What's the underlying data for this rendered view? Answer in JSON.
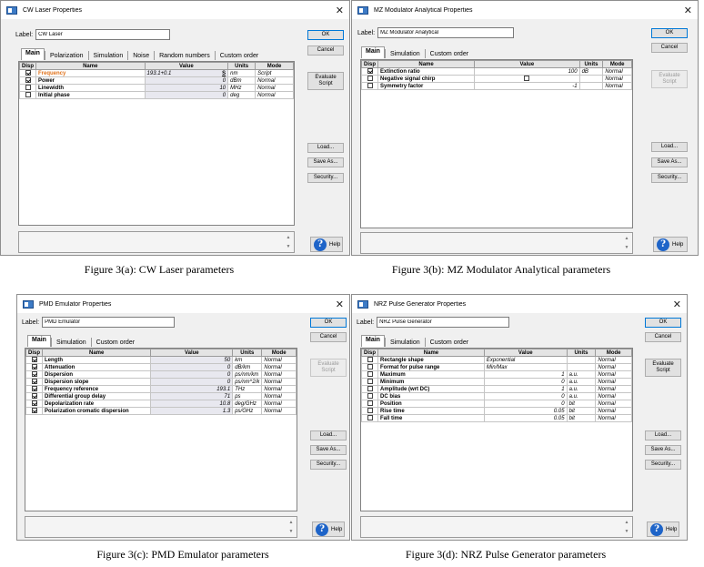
{
  "common": {
    "label_text": "Label:",
    "ok": "OK",
    "cancel": "Cancel",
    "evaluate_script": "Evaluate Script",
    "load": "Load...",
    "save_as": "Save As...",
    "security": "Security...",
    "help": "Help",
    "headers": {
      "disp": "Disp",
      "name": "Name",
      "value": "Value",
      "units": "Units",
      "mode": "Mode"
    }
  },
  "panel_a": {
    "title": "CW Laser Properties",
    "label_value": "CW Laser",
    "tabs": [
      "Main",
      "Polarization",
      "Simulation",
      "Noise",
      "Random numbers",
      "Custom order"
    ],
    "rows": [
      {
        "checked": true,
        "name": "Frequency",
        "value": "193.1+0.1",
        "units": "nm",
        "mode": "Script"
      },
      {
        "checked": true,
        "name": "Power",
        "value": "0",
        "units": "dBm",
        "mode": "Normal"
      },
      {
        "checked": false,
        "name": "Linewidth",
        "value": "10",
        "units": "MHz",
        "mode": "Normal"
      },
      {
        "checked": false,
        "name": "Initial phase",
        "value": "0",
        "units": "deg",
        "mode": "Normal"
      }
    ],
    "script_marker": "S",
    "caption": "Figure 3(a): CW Laser parameters"
  },
  "panel_b": {
    "title": "MZ Modulator Analytical Properties",
    "label_value": "MZ Modulator Analytical",
    "tabs": [
      "Main",
      "Simulation",
      "Custom order"
    ],
    "rows": [
      {
        "checked": true,
        "name": "Extinction ratio",
        "value": "100",
        "units": "dB",
        "mode": "Normal"
      },
      {
        "checked": false,
        "name": "Negative signal chirp",
        "value": "",
        "units": "",
        "mode": "Normal",
        "value_checkbox": true
      },
      {
        "checked": false,
        "name": "Symmetry factor",
        "value": "-1",
        "units": "",
        "mode": "Normal"
      }
    ],
    "caption": "Figure 3(b): MZ Modulator Analytical parameters"
  },
  "panel_c": {
    "title": "PMD Emulator Properties",
    "label_value": "PMD Emulator",
    "tabs": [
      "Main",
      "Simulation",
      "Custom order"
    ],
    "rows": [
      {
        "checked": true,
        "name": "Length",
        "value": "50",
        "units": "km",
        "mode": "Normal"
      },
      {
        "checked": true,
        "name": "Attenuation",
        "value": "0",
        "units": "dB/km",
        "mode": "Normal"
      },
      {
        "checked": true,
        "name": "Dispersion",
        "value": "0",
        "units": "ps/nm/km",
        "mode": "Normal"
      },
      {
        "checked": true,
        "name": "Dispersion slope",
        "value": "0",
        "units": "ps/nm^2/k",
        "mode": "Normal"
      },
      {
        "checked": true,
        "name": "Frequency reference",
        "value": "193.1",
        "units": "THz",
        "mode": "Normal"
      },
      {
        "checked": true,
        "name": "Differential group delay",
        "value": "71",
        "units": "ps",
        "mode": "Normal"
      },
      {
        "checked": true,
        "name": "Depolarization rate",
        "value": "10.8",
        "units": "deg/GHz",
        "mode": "Normal"
      },
      {
        "checked": true,
        "name": "Polarization cromatic dispersion",
        "value": "1.3",
        "units": "ps/GHz",
        "mode": "Normal"
      }
    ],
    "caption": "Figure 3(c): PMD Emulator parameters"
  },
  "panel_d": {
    "title": "NRZ Pulse Generator Properties",
    "label_value": "NRZ Pulse Generator",
    "tabs": [
      "Main",
      "Simulation",
      "Custom order"
    ],
    "rows": [
      {
        "checked": false,
        "name": "Rectangle shape",
        "value": "Exponential",
        "units": "",
        "mode": "Normal",
        "left": true
      },
      {
        "checked": false,
        "name": "Format for pulse range",
        "value": "Min/Max",
        "units": "",
        "mode": "Normal",
        "left": true
      },
      {
        "checked": false,
        "name": "Maximum",
        "value": "1",
        "units": "a.u.",
        "mode": "Normal"
      },
      {
        "checked": false,
        "name": "Minimum",
        "value": "0",
        "units": "a.u.",
        "mode": "Normal"
      },
      {
        "checked": false,
        "name": "Amplitude (wrt DC)",
        "value": "1",
        "units": "a.u.",
        "mode": "Normal"
      },
      {
        "checked": false,
        "name": "DC bias",
        "value": "0",
        "units": "a.u.",
        "mode": "Normal"
      },
      {
        "checked": false,
        "name": "Position",
        "value": "0",
        "units": "bit",
        "mode": "Normal"
      },
      {
        "checked": false,
        "name": "Rise time",
        "value": "0.05",
        "units": "bit",
        "mode": "Normal"
      },
      {
        "checked": false,
        "name": "Fall time",
        "value": "0.05",
        "units": "bit",
        "mode": "Normal"
      }
    ],
    "caption": "Figure 3(d): NRZ Pulse Generator parameters"
  }
}
